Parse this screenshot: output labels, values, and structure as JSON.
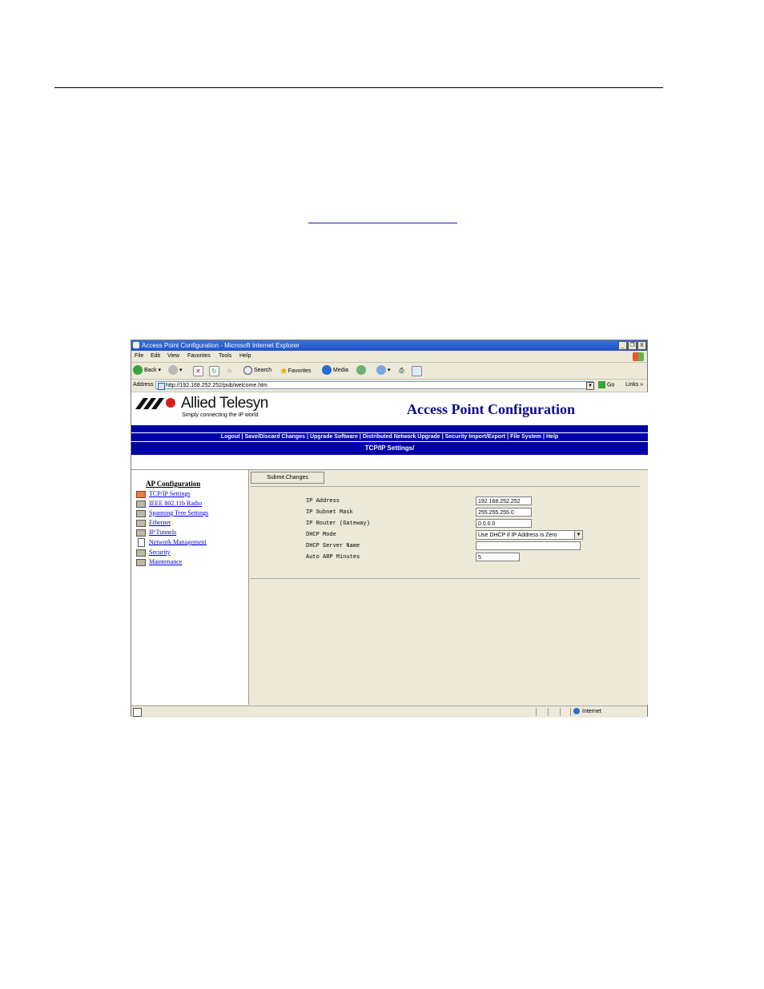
{
  "window": {
    "title": "Access Point Configuration - Microsoft Internet Explorer",
    "controls": [
      "_",
      "❐",
      "X"
    ]
  },
  "menubar": [
    "File",
    "Edit",
    "View",
    "Favorites",
    "Tools",
    "Help"
  ],
  "toolbar": {
    "back": "Back",
    "search": "Search",
    "favorites": "Favorites",
    "media": "Media"
  },
  "address": {
    "label": "Address",
    "url": "http://192.168.252.252/pub/welcome.htm",
    "go": "Go",
    "links": "Links"
  },
  "brand": {
    "name": "Allied Telesyn",
    "tagline": "Simply connecting the IP world"
  },
  "page": {
    "title": "Access Point Configuration",
    "nav": [
      "Logout",
      "Save/Discard Changes",
      "Upgrade Software",
      "Distributed Network Upgrade",
      "Security Import/Export",
      "File System",
      "Help"
    ],
    "section": "TCP/IP Settings/"
  },
  "tree": {
    "title": "AP Configuration",
    "items": [
      {
        "label": "TCP/IP Settings",
        "icon": "folder-open-icon"
      },
      {
        "label": "IEEE 802.11b Radio",
        "icon": "folder-icon"
      },
      {
        "label": "Spanning Tree Settings",
        "icon": "folder-icon"
      },
      {
        "label": "Ethernet",
        "icon": "folder-icon"
      },
      {
        "label": "IP Tunnels",
        "icon": "folder-icon"
      },
      {
        "label": "Network Management",
        "icon": "document-icon"
      },
      {
        "label": "Security",
        "icon": "folder-icon"
      },
      {
        "label": "Maintenance",
        "icon": "folder-icon"
      }
    ]
  },
  "form": {
    "submit": "Submit Changes",
    "fields": [
      {
        "label": "IP Address",
        "value": "192.168.252.252"
      },
      {
        "label": "IP Subnet Mask",
        "value": "255.255.255.0"
      },
      {
        "label": "IP Router (Gateway)",
        "value": "0.0.0.0"
      },
      {
        "label": "DHCP Mode",
        "value": "Use DHCP if IP Address is Zero"
      },
      {
        "label": "DHCP Server Name",
        "value": ""
      },
      {
        "label": "Auto ARP Minutes",
        "value": "5"
      }
    ]
  },
  "status": {
    "zone": "Internet"
  },
  "colors": {
    "nav_bar": "#0000a8",
    "title_text": "#0b0b8a",
    "link": "#0000cc",
    "titlebar": "#2152c8"
  }
}
